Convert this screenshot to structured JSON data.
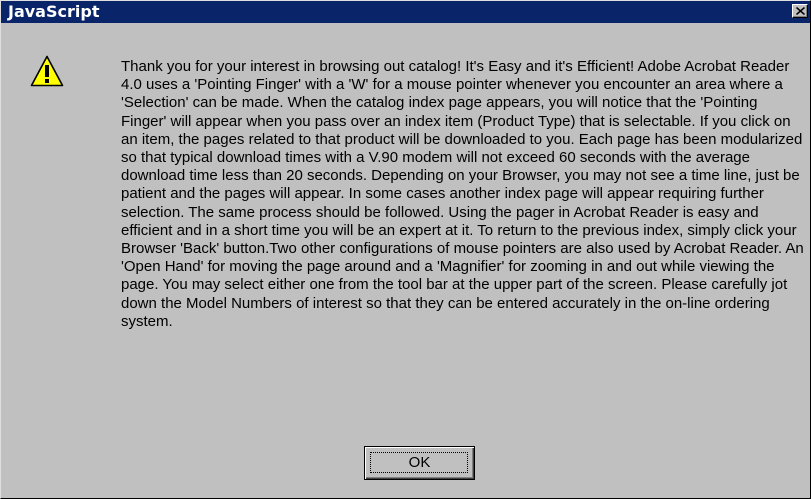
{
  "window": {
    "title": "JavaScript",
    "title_bar_color": "#0a246a",
    "close_icon": "close-icon"
  },
  "dialog": {
    "icon": "warning-icon",
    "icon_color": "#ffff00",
    "message": "Thank you for your interest in browsing out catalog!  It's Easy and it's Efficient! Adobe Acrobat Reader 4.0 uses a 'Pointing Finger' with a 'W' for a mouse pointer whenever you encounter an area where a 'Selection' can be made.  When the catalog index page appears, you will notice that the 'Pointing Finger' will appear when you pass over an index item (Product Type) that is selectable.  If you click on an item, the pages related to that product will be downloaded to you.  Each page has been modularized so that typical download times with a V.90 modem will not exceed 60 seconds with the average download time less than 20 seconds.  Depending on your Browser, you may not see a time line, just be patient and the pages will appear.  In some cases another index page will appear requiring further selection.  The same process should be followed.  Using the pager in Acrobat Reader is easy and efficient and in a short time you will be an expert at it.  To return to the previous index, simply click your Browser 'Back' button.Two other configurations of mouse pointers are also used by Acrobat Reader.  An 'Open Hand' for moving the page around and a 'Magnifier' for zooming in and out while viewing the page.  You may select either one from the tool bar at the upper part of the screen.  Please carefully jot down the Model Numbers of interest so that they can be entered accurately in the on-line ordering system.",
    "ok_label": "OK"
  }
}
